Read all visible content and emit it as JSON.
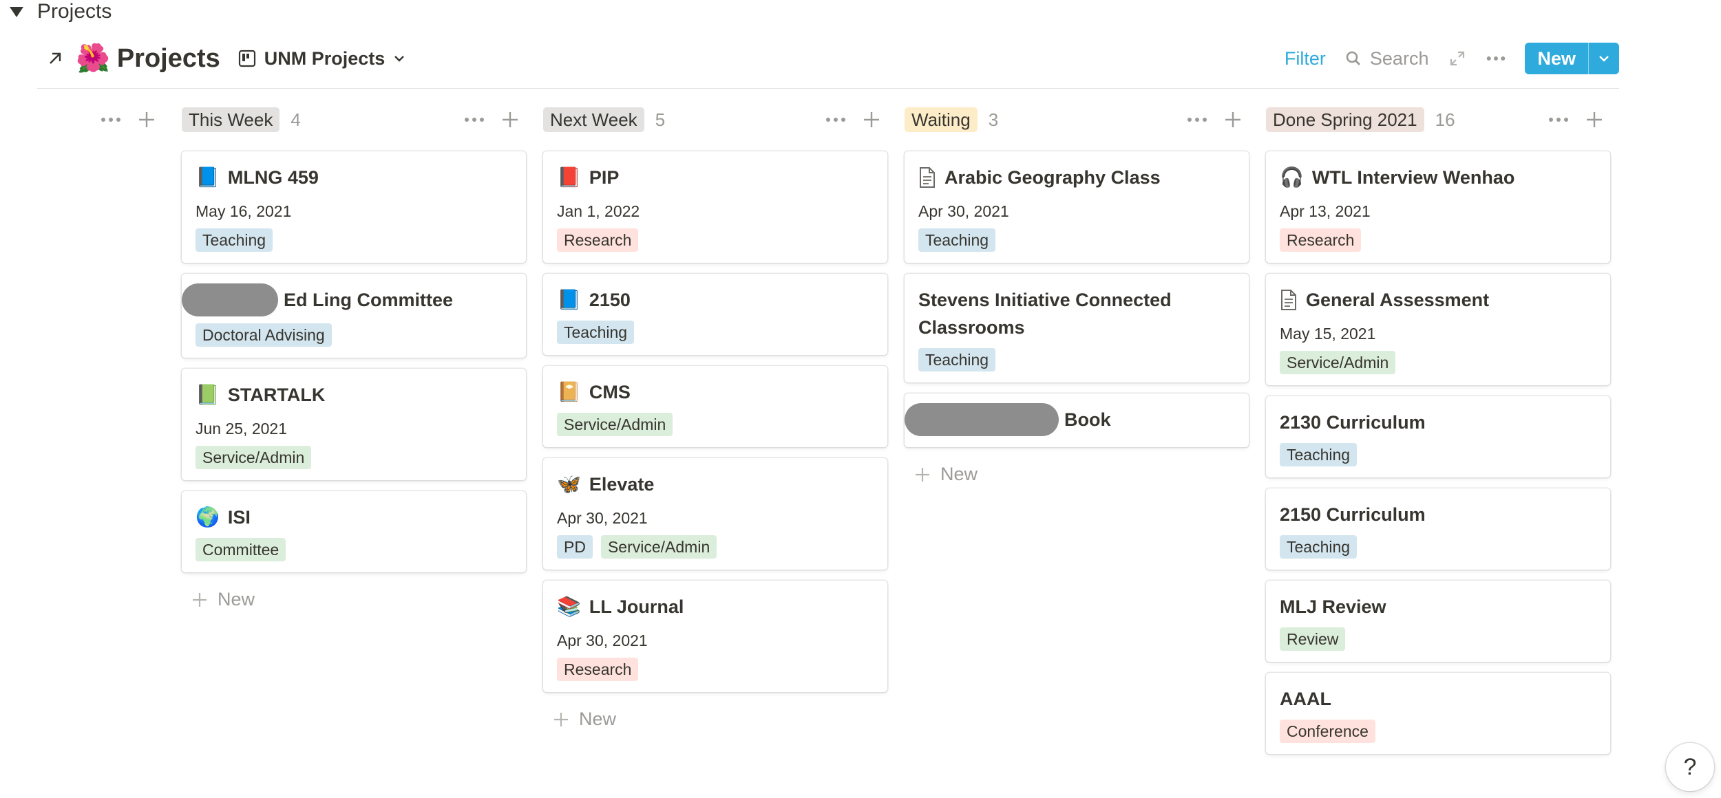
{
  "toggle": {
    "label": "Projects"
  },
  "header": {
    "emoji": "🌺",
    "title": "Projects",
    "view_name": "UNM Projects",
    "filter_label": "Filter",
    "search_label": "Search",
    "new_label": "New"
  },
  "colors": {
    "accent": "#2eaadc",
    "tag_blue": "#d3e5ef",
    "tag_red": "#ffe2dd",
    "tag_green": "#dbeddb",
    "group_gray": "#e3e2e0",
    "group_yellow": "#fdecc8",
    "group_brown": "#eee0da"
  },
  "columns": [
    {
      "name": "This Week",
      "count": "4",
      "color": "#e3e2e0",
      "cards": [
        {
          "emoji": "📘",
          "title": "MLNG 459",
          "date": "May 16, 2021",
          "tags": [
            {
              "label": "Teaching",
              "color": "#d3e5ef"
            }
          ]
        },
        {
          "emoji": "",
          "redacted": true,
          "title": "Ed Ling Committee",
          "date": "",
          "tags": [
            {
              "label": "Doctoral Advising",
              "color": "#d3e5ef"
            }
          ]
        },
        {
          "emoji": "📗",
          "title": "STARTALK",
          "date": "Jun 25, 2021",
          "tags": [
            {
              "label": "Service/Admin",
              "color": "#dbeddb"
            }
          ]
        },
        {
          "emoji": "🌍",
          "title": "ISI",
          "date": "",
          "tags": [
            {
              "label": "Committee",
              "color": "#dbeddb"
            }
          ]
        }
      ],
      "new_label": "New"
    },
    {
      "name": "Next Week",
      "count": "5",
      "color": "#e3e2e0",
      "cards": [
        {
          "emoji": "📕",
          "title": "PIP",
          "date": "Jan 1, 2022",
          "tags": [
            {
              "label": "Research",
              "color": "#ffe2dd"
            }
          ]
        },
        {
          "emoji": "📘",
          "title": "2150",
          "date": "",
          "tags": [
            {
              "label": "Teaching",
              "color": "#d3e5ef"
            }
          ]
        },
        {
          "emoji": "📔",
          "title": "CMS",
          "date": "",
          "tags": [
            {
              "label": "Service/Admin",
              "color": "#dbeddb"
            }
          ]
        },
        {
          "emoji": "🦋",
          "title": "Elevate",
          "date": "Apr 30, 2021",
          "tags": [
            {
              "label": "PD",
              "color": "#d3e5ef"
            },
            {
              "label": "Service/Admin",
              "color": "#dbeddb"
            }
          ]
        },
        {
          "emoji": "📚",
          "title": "LL Journal",
          "date": "Apr 30, 2021",
          "tags": [
            {
              "label": "Research",
              "color": "#ffe2dd"
            }
          ]
        }
      ],
      "new_label": "New"
    },
    {
      "name": "Waiting",
      "count": "3",
      "color": "#fdecc8",
      "cards": [
        {
          "emoji": "doc",
          "title": "Arabic Geography Class",
          "date": "Apr 30, 2021",
          "tags": [
            {
              "label": "Teaching",
              "color": "#d3e5ef"
            }
          ]
        },
        {
          "emoji": "",
          "title": "Stevens Initiative Connected Classrooms",
          "date": "",
          "tags": [
            {
              "label": "Teaching",
              "color": "#d3e5ef"
            }
          ]
        },
        {
          "emoji": "",
          "redacted": true,
          "redact_wide": true,
          "title": "Book",
          "date": "",
          "tags": []
        }
      ],
      "new_label": "New"
    },
    {
      "name": "Done Spring 2021",
      "count": "16",
      "color": "#eee0da",
      "cards": [
        {
          "emoji": "🎧",
          "title": "WTL Interview Wenhao",
          "date": "Apr 13, 2021",
          "tags": [
            {
              "label": "Research",
              "color": "#ffe2dd"
            }
          ]
        },
        {
          "emoji": "doc",
          "title": "General Assessment",
          "date": "May 15, 2021",
          "tags": [
            {
              "label": "Service/Admin",
              "color": "#dbeddb"
            }
          ]
        },
        {
          "emoji": "",
          "title": "2130 Curriculum",
          "date": "",
          "tags": [
            {
              "label": "Teaching",
              "color": "#d3e5ef"
            }
          ]
        },
        {
          "emoji": "",
          "title": "2150 Curriculum",
          "date": "",
          "tags": [
            {
              "label": "Teaching",
              "color": "#d3e5ef"
            }
          ]
        },
        {
          "emoji": "",
          "title": "MLJ Review",
          "date": "",
          "tags": [
            {
              "label": "Review",
              "color": "#dbeddb"
            }
          ]
        },
        {
          "emoji": "",
          "title": "AAAL",
          "date": "",
          "tags": [
            {
              "label": "Conference",
              "color": "#ffe2dd"
            }
          ]
        }
      ],
      "new_label": ""
    }
  ],
  "help_label": "?"
}
